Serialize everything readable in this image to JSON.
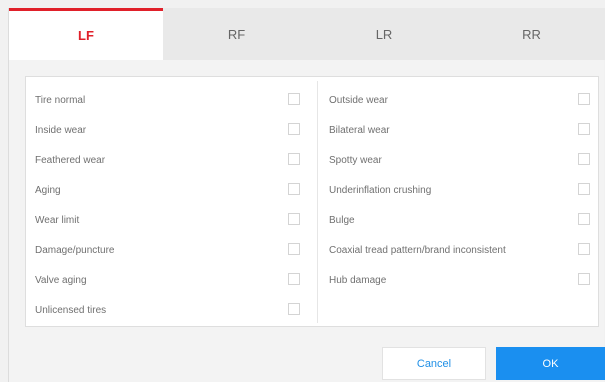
{
  "tabs": [
    {
      "label": "LF",
      "active": true
    },
    {
      "label": "RF",
      "active": false
    },
    {
      "label": "LR",
      "active": false
    },
    {
      "label": "RR",
      "active": false
    }
  ],
  "left_items": [
    {
      "label": "Tire normal",
      "checked": false
    },
    {
      "label": "Inside wear",
      "checked": false
    },
    {
      "label": "Feathered wear",
      "checked": false
    },
    {
      "label": "Aging",
      "checked": false
    },
    {
      "label": "Wear limit",
      "checked": false
    },
    {
      "label": "Damage/puncture",
      "checked": false
    },
    {
      "label": "Valve aging",
      "checked": false
    },
    {
      "label": "Unlicensed tires",
      "checked": false
    }
  ],
  "right_items": [
    {
      "label": "Outside wear",
      "checked": false
    },
    {
      "label": "Bilateral wear",
      "checked": false
    },
    {
      "label": "Spotty wear",
      "checked": false
    },
    {
      "label": "Underinflation crushing",
      "checked": false
    },
    {
      "label": "Bulge",
      "checked": false
    },
    {
      "label": "Coaxial tread pattern/brand inconsistent",
      "checked": false
    },
    {
      "label": "Hub damage",
      "checked": false
    }
  ],
  "buttons": {
    "cancel_label": "Cancel",
    "ok_label": "OK"
  },
  "colors": {
    "accent_red": "#e0202a",
    "primary_blue": "#1a8ff0"
  }
}
